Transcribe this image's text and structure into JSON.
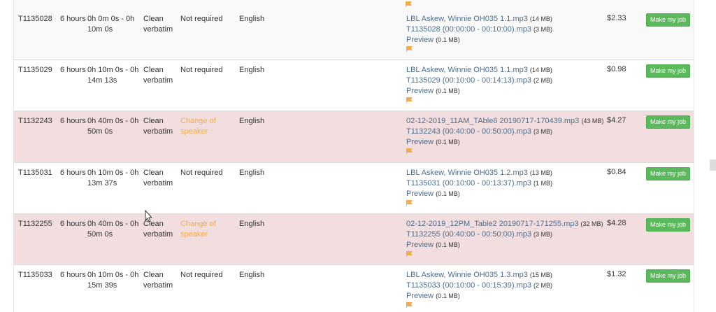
{
  "colors": {
    "alert_row": "#f2dede",
    "stripe_row": "#f9f9f9",
    "link": "#4e6d8c",
    "warn": "#f0ad4e",
    "button": "#5cb85c"
  },
  "jobs": [
    {
      "id": "T1135028",
      "hours": "6 hours",
      "range": "0h 0m 0s - 0h 10m 0s",
      "style": "Clean verbatim",
      "speaker": "Not required",
      "language": "English",
      "file1": {
        "name": "LBL Askew, Winnie OH035 1.1.mp3",
        "size": "(14 MB)"
      },
      "file2": {
        "name": "T1135028 (00:00:00 - 00:10:00).mp3",
        "size": "(3 MB)"
      },
      "preview": {
        "label": "Preview",
        "size": "(0.1 MB)"
      },
      "price": "$2.33",
      "action": "Make my job"
    },
    {
      "id": "T1135029",
      "hours": "6 hours",
      "range": "0h 10m 0s - 0h 14m 13s",
      "style": "Clean verbatim",
      "speaker": "Not required",
      "language": "English",
      "file1": {
        "name": "LBL Askew, Winnie OH035 1.1.mp3",
        "size": "(14 MB)"
      },
      "file2": {
        "name": "T1135029 (00:10:00 - 00:14:13).mp3",
        "size": "(2 MB)"
      },
      "preview": {
        "label": "Preview",
        "size": "(0.1 MB)"
      },
      "price": "$0.98",
      "action": "Make my job"
    },
    {
      "id": "T1132243",
      "hours": "6 hours",
      "range": "0h 40m 0s - 0h 50m 0s",
      "style": "Clean verbatim",
      "speaker": "Change of speaker",
      "language": "English",
      "file1": {
        "name": "02-12-2019_11AM_TAble6 20190717-170439.mp3",
        "size": "(43 MB)"
      },
      "file2": {
        "name": "T1132243 (00:40:00 - 00:50:00).mp3",
        "size": "(3 MB)"
      },
      "preview": {
        "label": "Preview",
        "size": "(0.1 MB)"
      },
      "price": "$4.27",
      "action": "Make my job"
    },
    {
      "id": "T1135031",
      "hours": "6 hours",
      "range": "0h 10m 0s - 0h 13m 37s",
      "style": "Clean verbatim",
      "speaker": "Not required",
      "language": "English",
      "file1": {
        "name": "LBL Askew, Winnie OH035 1.2.mp3",
        "size": "(13 MB)"
      },
      "file2": {
        "name": "T1135031 (00:10:00 - 00:13:37).mp3",
        "size": "(1 MB)"
      },
      "preview": {
        "label": "Preview",
        "size": "(0.1 MB)"
      },
      "price": "$0.84",
      "action": "Make my job"
    },
    {
      "id": "T1132255",
      "hours": "6 hours",
      "range": "0h 40m 0s - 0h 50m 0s",
      "style": "Clean verbatim",
      "speaker": "Change of speaker",
      "language": "English",
      "file1": {
        "name": "02-12-2019_12PM_Table2 20190717-171255.mp3",
        "size": "(32 MB)"
      },
      "file2": {
        "name": "T1132255 (00:40:00 - 00:50:00).mp3",
        "size": "(3 MB)"
      },
      "preview": {
        "label": "Preview",
        "size": "(0.1 MB)"
      },
      "price": "$4.28",
      "action": "Make my job"
    },
    {
      "id": "T1135033",
      "hours": "6 hours",
      "range": "0h 10m 0s - 0h 15m 39s",
      "style": "Clean verbatim",
      "speaker": "Not required",
      "language": "English",
      "file1": {
        "name": "LBL Askew, Winnie OH035 1.3.mp3",
        "size": "(15 MB)"
      },
      "file2": {
        "name": "T1135033 (00:10:00 - 00:15:39).mp3",
        "size": "(2 MB)"
      },
      "preview": {
        "label": "Preview",
        "size": "(0.1 MB)"
      },
      "price": "$1.32",
      "action": "Make my job"
    }
  ]
}
